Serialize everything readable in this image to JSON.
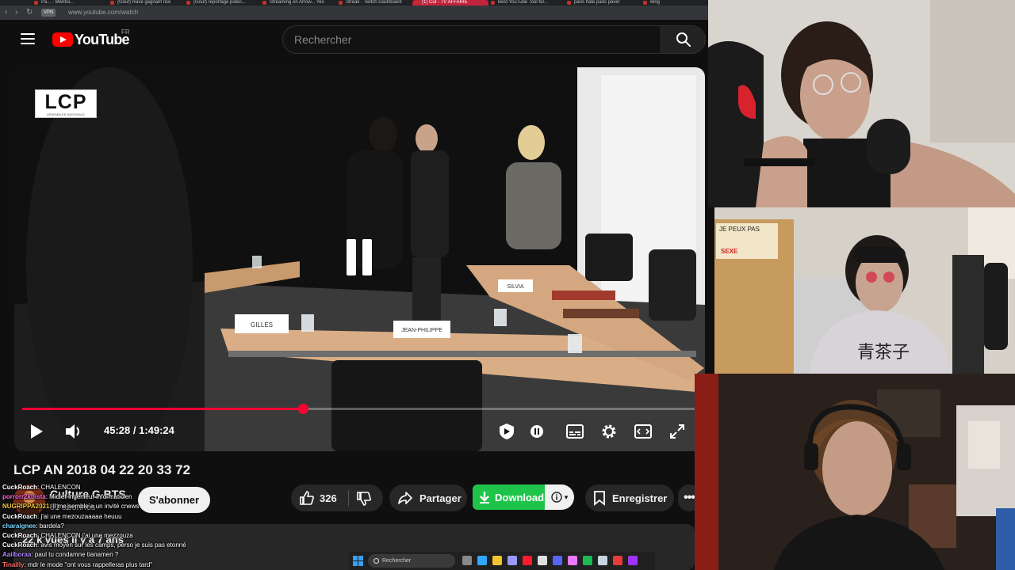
{
  "browser": {
    "tabs": [
      "Pa... - Mentra...",
      "(Gout) Rave gagnant rise",
      "(Gout) reportage polen...",
      "Streaming on Arrow... Yes",
      "Streak - Twitch Dashboard",
      "(1) Cut - TV AFFAIRE",
      "Best YouTube Tool for...",
      "paris hate paris paver",
      "Bing"
    ],
    "active_tab_index": 5,
    "vpn_label": "VPN",
    "url": "www.youtube.com/watch"
  },
  "youtube": {
    "logo_text": "YouTube",
    "region": "FR",
    "search_placeholder": "Rechercher"
  },
  "player": {
    "channel_watermark": "LCP",
    "watermark_subtitle": "ASSEMBLEE NATIONALE",
    "current_time": "45:28",
    "duration": "1:49:24",
    "time_display": "45:28 / 1:49:24",
    "progress_fraction": 0.4156,
    "state": "paused",
    "name_cards": [
      "GILLES",
      "JEAN-PHILIPPE",
      "SILVIA"
    ]
  },
  "video": {
    "title": "LCP AN 2018 04 22 20 33 72",
    "channel_name": "Culture G BTS",
    "subscribers": "61 abonnés",
    "subscribe_label": "S'abonner",
    "likes": "326",
    "share_label": "Partager",
    "download_label": "Download",
    "save_label": "Enregistrer",
    "views": "22 k vues  il y a 7 ans"
  },
  "chat": [
    {
      "user": "CuckRoach",
      "color": "#ffffff",
      "text": "CHALENCON"
    },
    {
      "user": "porrorr2kbista",
      "color": "#ff6ad5",
      "text": "Midlet-ingénieur informaticien"
    },
    {
      "user": "NUGRIPPA2021",
      "color": "#f5c542",
      "text": "il me semble a un invité cnews"
    },
    {
      "user": "CuckRoach",
      "color": "#ffffff",
      "text": "j'ai une mezouzaaaaa heuuu"
    },
    {
      "user": "charaignee",
      "color": "#7fd4ff",
      "text": "bardela?"
    },
    {
      "user": "CuckRoach",
      "color": "#ffffff",
      "text": "CHALENCON j'ai une mezzouza"
    },
    {
      "user": "CuckRoach",
      "color": "#ffffff",
      "text": "avis moyen sur les camps, perso je suis pas etonné"
    },
    {
      "user": "Aaiiboraa",
      "color": "#b388ff",
      "text": "paul tu condamne tianamen ?"
    },
    {
      "user": "Tinailly",
      "color": "#ff6b6b",
      "text": "mdr le mode \"ont vous rappelleras plus tard\""
    }
  ],
  "taskbar": {
    "search_label": "Rechercher",
    "app_icons": [
      "file-explorer-icon",
      "photoshop-icon",
      "folder-icon",
      "premiere-icon",
      "opera-icon",
      "obs-icon",
      "discord-icon",
      "premiere2-icon",
      "spotify-icon",
      "steam-icon",
      "record-icon",
      "messenger-icon"
    ],
    "icon_colors": [
      "#888888",
      "#31a8ff",
      "#f4c430",
      "#9999ff",
      "#ff1b2d",
      "#e0e0e0",
      "#5865f2",
      "#ea77ff",
      "#1db954",
      "#c7d5e0",
      "#e33b3b",
      "#a033ff"
    ]
  },
  "colors": {
    "youtube_red": "#ff0000",
    "progress_red": "#ff0033",
    "download_green": "#1ec44a"
  }
}
